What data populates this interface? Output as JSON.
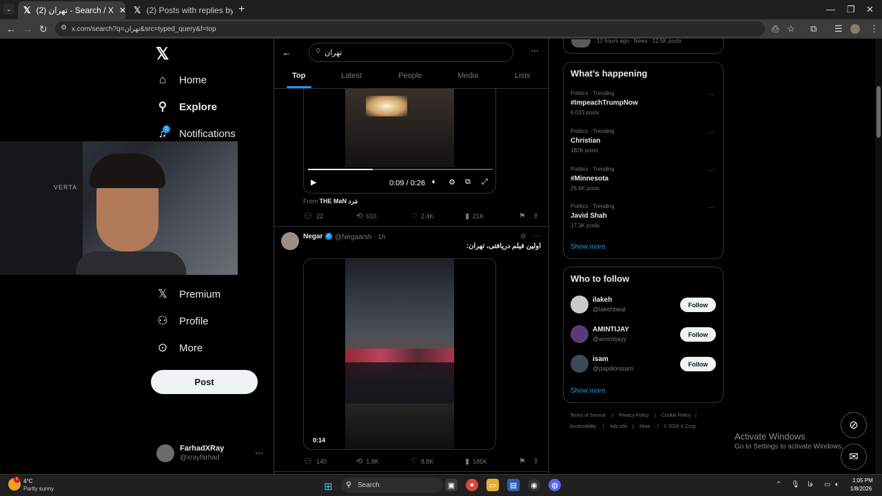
{
  "browser": {
    "tabs": [
      {
        "label": "(2) تهران - Search / X",
        "icon": "x-icon"
      },
      {
        "label": "(2) Posts with replies by Reza P…",
        "icon": "x-icon"
      }
    ],
    "url": "x.com/search?q=تهران&src=typed_query&f=top"
  },
  "nav": {
    "items": [
      {
        "label": "Home",
        "icon": "home-icon"
      },
      {
        "label": "Explore",
        "icon": "search-icon"
      },
      {
        "label": "Notifications",
        "icon": "bell-icon",
        "badge": "2"
      },
      {
        "label": "Premium",
        "icon": "x-icon"
      },
      {
        "label": "Profile",
        "icon": "person-icon"
      },
      {
        "label": "More",
        "icon": "more-circle-icon"
      }
    ],
    "post_button": "Post",
    "account": {
      "name": "FarhadXRay",
      "handle": "@xrayfarhad"
    }
  },
  "search": {
    "query": "تهران",
    "tabs": [
      "Top",
      "Latest",
      "People",
      "Media",
      "Lists"
    ],
    "active_tab": "Top"
  },
  "post1": {
    "video_time": "0:09 / 0:26",
    "progress": 0.35,
    "from_label": "From",
    "from_name": "THE MaN مَرد",
    "replies": "22",
    "reposts": "610",
    "likes": "2.4K",
    "views": "21K"
  },
  "post2": {
    "name": "Negar",
    "handle": "@Negaarsh · 1h",
    "text": "اولین فیلم دریافتی، تهران:",
    "video_duration": "0:14",
    "replies": "140",
    "reposts": "1.8K",
    "likes": "8.8K",
    "views": "185K"
  },
  "news": {
    "meta": "12 hours ago · News · 12.5K posts"
  },
  "happening": {
    "title": "What’s happening",
    "trends": [
      {
        "meta": "Politics · Trending",
        "name": "#ImpeachTrumpNow",
        "count": "6,033 posts"
      },
      {
        "meta": "Politics · Trending",
        "name": "Christian",
        "count": "182K posts"
      },
      {
        "meta": "Politics · Trending",
        "name": "#Minnesota",
        "count": "26.6K posts"
      },
      {
        "meta": "Politics · Trending",
        "name": "Javid Shah",
        "count": "17.3K posts"
      }
    ],
    "show_more": "Show more"
  },
  "who_to_follow": {
    "title": "Who to follow",
    "users": [
      {
        "name": "ilakeh",
        "handle": "@lakehbeat",
        "button": "Follow"
      },
      {
        "name": "AMINTIJAY",
        "handle": "@amintijayy",
        "button": "Follow"
      },
      {
        "name": "isam",
        "handle": "@papillonisam",
        "button": "Follow"
      }
    ],
    "show_more": "Show more"
  },
  "footer": {
    "links": [
      "Terms of Service",
      "Privacy Policy",
      "Cookie Policy",
      "Accessibility",
      "Ads info",
      "More ···",
      "© 2026 X Corp."
    ]
  },
  "watermark": {
    "line1": "Activate Windows",
    "line2": "Go to Settings to activate Windows."
  },
  "taskbar": {
    "weather_temp": "4°C",
    "weather_desc": "Partly sunny",
    "weather_badge": "1",
    "search_placeholder": "Search",
    "lang": "فا",
    "time": "1:05 PM",
    "date": "1/8/2026"
  },
  "webcam": {
    "chair_text": "VERTA"
  },
  "colors": {
    "accent": "#1d9bf0",
    "background": "#000000",
    "border": "#2f3336",
    "muted": "#71767b"
  }
}
